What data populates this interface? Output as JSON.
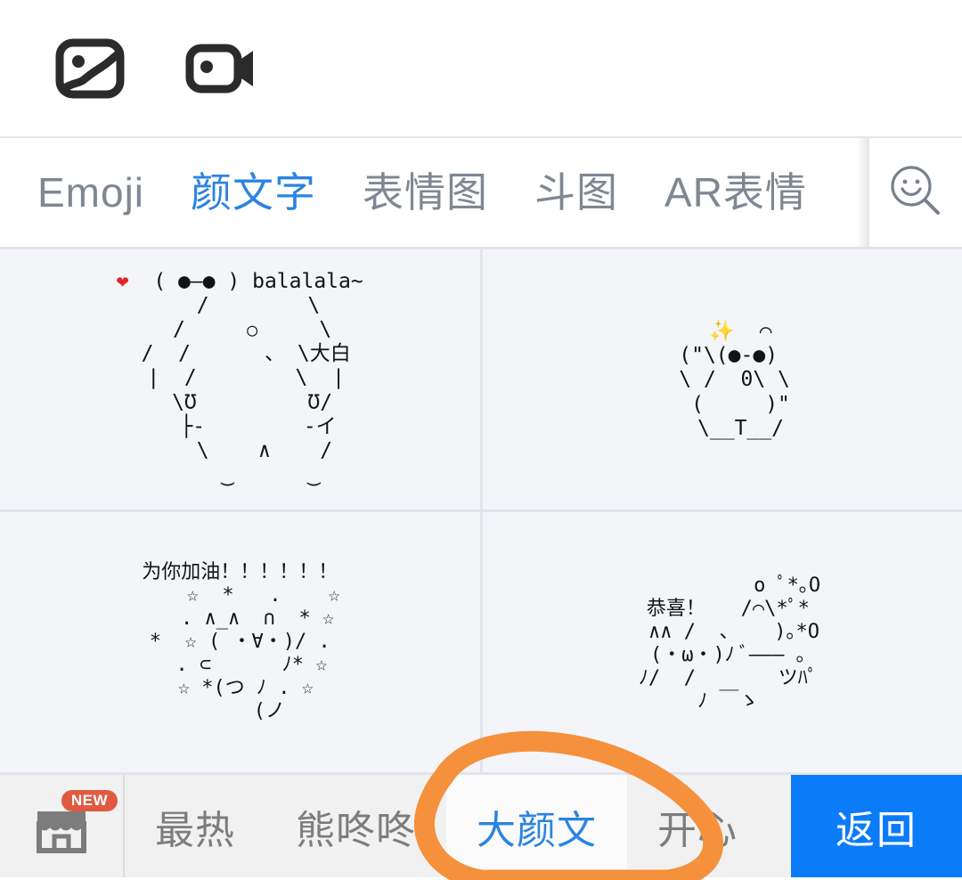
{
  "toolbar": {
    "buttons": [
      {
        "name": "photo-icon",
        "label": "图片"
      },
      {
        "name": "video-icon",
        "label": "视频"
      }
    ]
  },
  "category_tabs": {
    "items": [
      {
        "label": "Emoji",
        "active": false
      },
      {
        "label": "颜文字",
        "active": true
      },
      {
        "label": "表情图",
        "active": false
      },
      {
        "label": "斗图",
        "active": false
      },
      {
        "label": "AR表情",
        "active": false
      }
    ],
    "search_icon": "smiley-search-icon",
    "active_color": "#2b84e0",
    "inactive_color": "#7f8792"
  },
  "grid": {
    "cells": [
      {
        "id": "kaomoji-baymax",
        "caption": "大白",
        "text": "❤ ( ●—● ) balalala~\n  /       \\\n /    ○    \\\n/  /    、  \\大白\n|  /       \\  |\n \\Ʊ         Ʊ/\n  ├-       -イ\n   \\   ∧   /\n    ‿     ‿"
      },
      {
        "id": "kaomoji-sparkle-bear",
        "caption": "",
        "text": "✨     ⌒\n(\"\\(●-●)\n \\ /  0\\ \\\n  (      )\"\n  \\__T__/"
      },
      {
        "id": "kaomoji-cheer",
        "caption": "为你加油",
        "text": "为你加油！！！！！！\n   ☆  *   .    ☆\n   . ∧_∧  ∩  * ☆\n* ☆ ( ・∀・)/ .\n  . ⊂      ﾉ* ☆\n☆ *(つ ﾉ .☆\n    (ノ"
      },
      {
        "id": "kaomoji-congrats",
        "caption": "恭喜",
        "text": "          o ﾟ*｡O\n恭喜！   /⌒\\*ﾟ*\n  ∧∧ / 、  )｡*O\n (・ω・)ﾉ ﾞ——ﾟ\n ﾉ/ /      ツﾊﾟ\n ﾉ ￣ゝ"
      }
    ]
  },
  "bottom_bar": {
    "store": {
      "icon": "store-icon",
      "badge": "NEW"
    },
    "tabs": [
      {
        "label": "最热",
        "active": false
      },
      {
        "label": "熊咚咚",
        "active": false
      },
      {
        "label": "大颜文",
        "active": true
      },
      {
        "label": "开心",
        "active": false
      }
    ],
    "back_button": {
      "label": "返回",
      "color": "#0a7cfa"
    }
  },
  "annotation": {
    "shape": "orange-ellipse-highlight",
    "color": "#f5903c",
    "target": "大颜文"
  }
}
